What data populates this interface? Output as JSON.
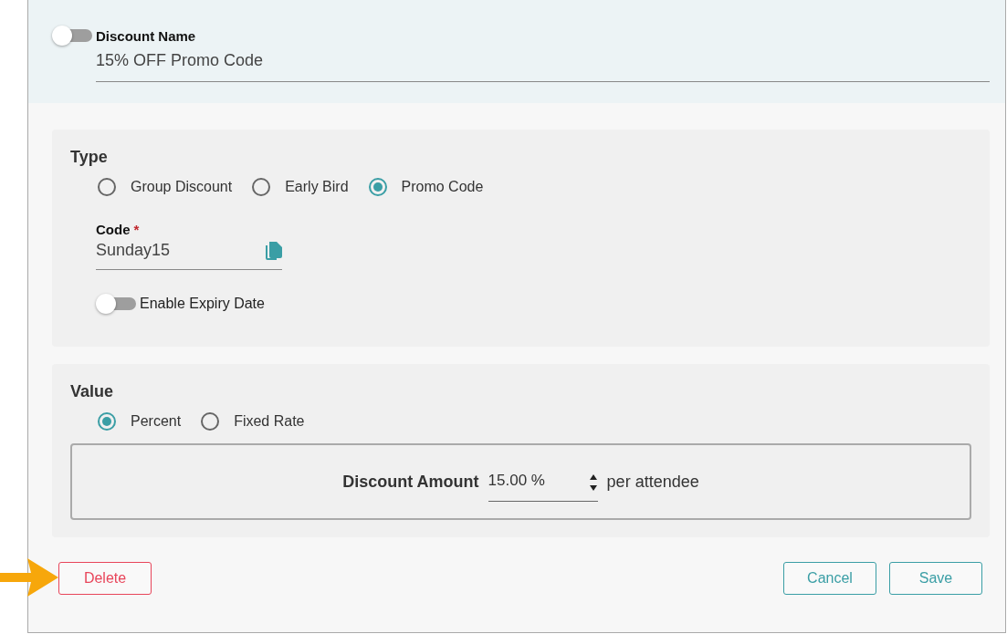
{
  "header": {
    "toggle_on": false,
    "label": "Discount Name",
    "value": "15% OFF Promo Code"
  },
  "type_section": {
    "title": "Type",
    "options": [
      {
        "label": "Group Discount",
        "selected": false
      },
      {
        "label": "Early Bird",
        "selected": false
      },
      {
        "label": "Promo Code",
        "selected": true
      }
    ],
    "code": {
      "label": "Code",
      "required_mark": "*",
      "value": "Sunday15"
    },
    "expiry": {
      "label": "Enable Expiry Date",
      "on": false
    }
  },
  "value_section": {
    "title": "Value",
    "options": [
      {
        "label": "Percent",
        "selected": true
      },
      {
        "label": "Fixed Rate",
        "selected": false
      }
    ],
    "amount": {
      "label": "Discount Amount",
      "value": "15.00 %",
      "suffix": "per attendee"
    }
  },
  "buttons": [
    {
      "label": "Delete",
      "kind": "danger"
    },
    {
      "label": "Cancel",
      "kind": "secondary"
    },
    {
      "label": "Save",
      "kind": "secondary"
    }
  ]
}
